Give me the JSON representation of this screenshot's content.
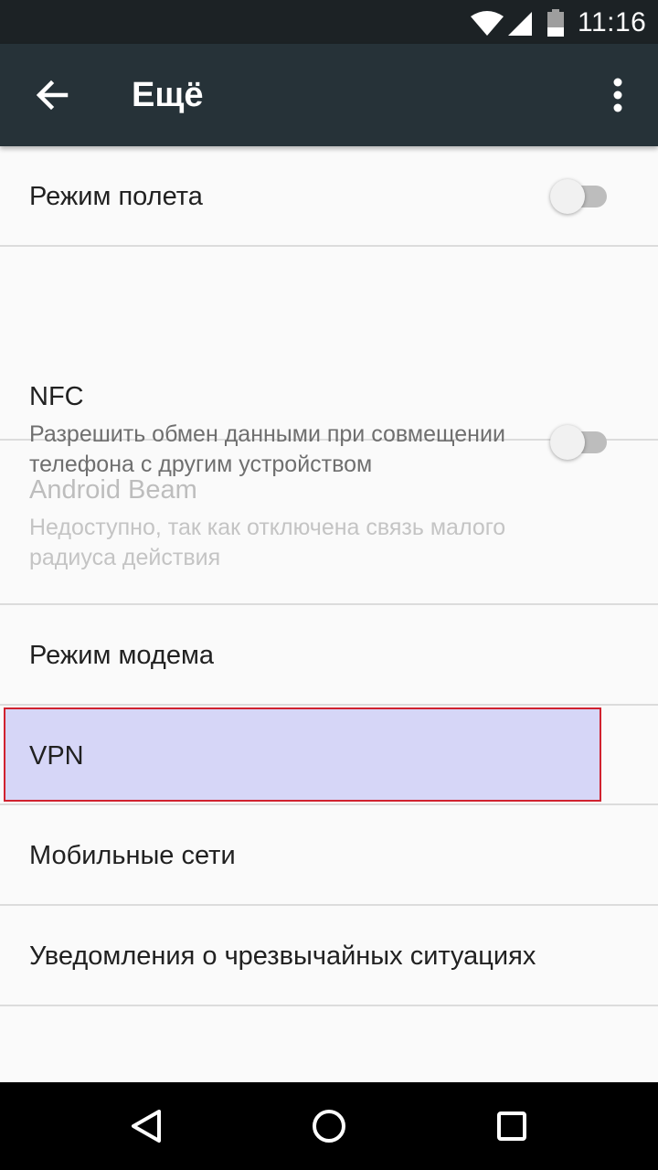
{
  "status_bar": {
    "time": "11:16",
    "icons": [
      "wifi-icon",
      "cell-signal-icon",
      "battery-icon"
    ]
  },
  "app_bar": {
    "title": "Ещё",
    "back_icon": "arrow-back-icon",
    "overflow_icon": "more-vert-icon",
    "background": "#263238"
  },
  "list": {
    "items": [
      {
        "title": "Режим полета",
        "toggle": "off"
      },
      {
        "title": "NFC",
        "subtitle": "Разрешить обмен данными при совмещении телефона с другим устройством",
        "toggle": "off"
      },
      {
        "title": "Android Beam",
        "subtitle": "Недоступно, так как отключена связь малого радиуса действия",
        "disabled": true
      },
      {
        "title": "Режим модема"
      },
      {
        "title": "VPN",
        "highlighted": true
      },
      {
        "title": "Мобильные сети"
      },
      {
        "title": "Уведомления о чрезвычайных ситуациях"
      }
    ]
  },
  "nav_bar": {
    "icons": [
      "back-triangle-icon",
      "home-circle-icon",
      "recents-square-icon"
    ]
  },
  "colors": {
    "highlight_fill": "#d6d6f7",
    "highlight_border": "#d0222f",
    "toggle_off_track": "#bdbdbd"
  }
}
